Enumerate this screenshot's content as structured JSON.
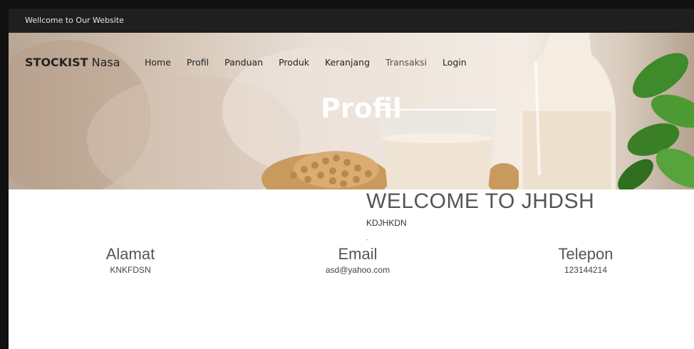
{
  "topbar": {
    "welcome_text": "Wellcome to Our Website"
  },
  "brand": {
    "strong": "STOCKIST",
    "light": " Nasa"
  },
  "nav": {
    "items": [
      {
        "label": "Home"
      },
      {
        "label": "Profil"
      },
      {
        "label": "Panduan"
      },
      {
        "label": "Produk"
      },
      {
        "label": "Keranjang"
      },
      {
        "label": "Transaksi"
      },
      {
        "label": "Login"
      }
    ]
  },
  "hero": {
    "title": "Profil"
  },
  "main": {
    "heading": "WELCOME TO JHDSH",
    "subheading": "KDJHKDN",
    "separator": "-"
  },
  "info": {
    "alamat": {
      "title": "Alamat",
      "value": "KNKFDSN"
    },
    "email": {
      "title": "Email",
      "value": "asd@yahoo.com"
    },
    "telepon": {
      "title": "Telepon",
      "value": "123144214"
    }
  },
  "colors": {
    "topbar_bg": "#1f1f1f",
    "hero_title": "#ffffff",
    "text_grey": "#555555"
  }
}
